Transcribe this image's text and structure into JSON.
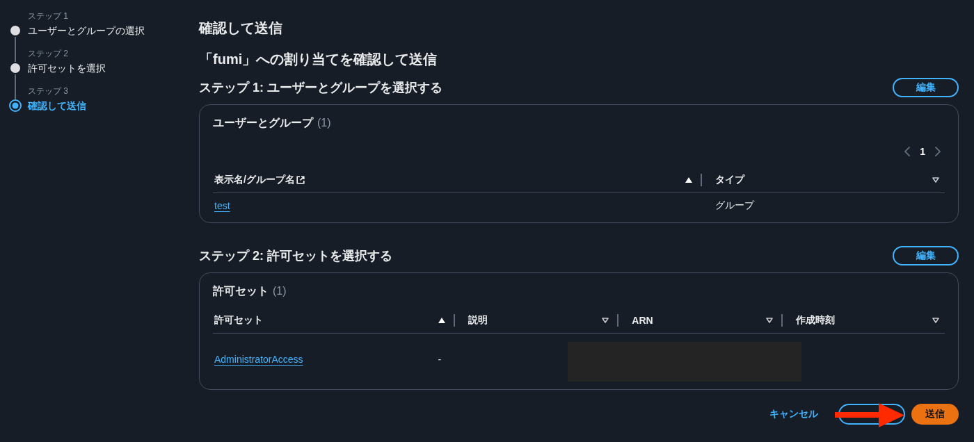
{
  "wizard_steps": [
    {
      "label": "ステップ 1",
      "title": "ユーザーとグループの選択",
      "selected": false
    },
    {
      "label": "ステップ 2",
      "title": "許可セットを選択",
      "selected": false
    },
    {
      "label": "ステップ 3",
      "title": "確認して送信",
      "selected": true
    }
  ],
  "page_title": "確認して送信",
  "subtitle": "「fumi」への割り当てを確認して送信",
  "sections": [
    {
      "heading": "ステップ 1: ユーザーとグループを選択する",
      "edit_button": "編集",
      "table": {
        "title": "ユーザーとグループ",
        "count": "(1)",
        "pagination": {
          "page": "1",
          "prev_disabled": true,
          "next_disabled": true
        },
        "columns": [
          {
            "label": "表示名/グループ名",
            "link_icon": true,
            "sorted": true
          },
          {
            "label": "タイプ",
            "link_icon": false,
            "sorted": false
          }
        ],
        "rows": [
          {
            "cells": [
              {
                "kind": "link",
                "text": "test"
              },
              {
                "kind": "text",
                "text": "グループ"
              }
            ]
          }
        ]
      }
    },
    {
      "heading": "ステップ 2: 許可セットを選択する",
      "edit_button": "編集",
      "table": {
        "title": "許可セット",
        "count": "(1)",
        "columns": [
          {
            "label": "許可セット",
            "link_icon": false,
            "sorted": true
          },
          {
            "label": "説明",
            "link_icon": false,
            "sorted": false
          },
          {
            "label": "ARN",
            "link_icon": false,
            "sorted": false
          },
          {
            "label": "作成時刻",
            "link_icon": false,
            "sorted": false
          }
        ],
        "rows": [
          {
            "cells": [
              {
                "kind": "link",
                "text": "AdministratorAccess"
              },
              {
                "kind": "text",
                "text": "-"
              },
              {
                "kind": "redacted"
              }
            ]
          }
        ]
      }
    }
  ],
  "footer": {
    "buttons": [
      {
        "kind": "link",
        "label": "キャンセル"
      },
      {
        "kind": "outline"
      },
      {
        "kind": "primary",
        "label": "送信"
      }
    ]
  }
}
